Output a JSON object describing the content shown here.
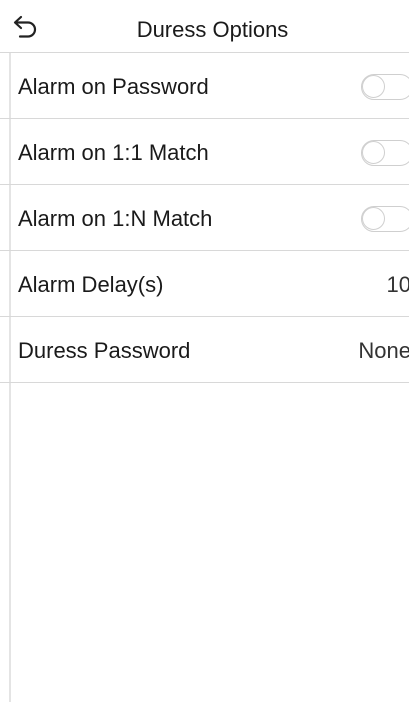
{
  "header": {
    "title": "Duress Options",
    "back_icon": "back-arrow-icon"
  },
  "settings": [
    {
      "label": "Alarm on Password",
      "type": "toggle",
      "enabled": false
    },
    {
      "label": "Alarm on 1:1 Match",
      "type": "toggle",
      "enabled": false
    },
    {
      "label": "Alarm on 1:N Match",
      "type": "toggle",
      "enabled": false
    },
    {
      "label": "Alarm Delay(s)",
      "type": "value",
      "value": "10"
    },
    {
      "label": "Duress Password",
      "type": "value",
      "value": "None"
    }
  ],
  "colors": {
    "background": "#ffffff",
    "divider": "#d8d8d8",
    "toggle_off": "#cfcfcf",
    "text": "#1a1a1a"
  }
}
